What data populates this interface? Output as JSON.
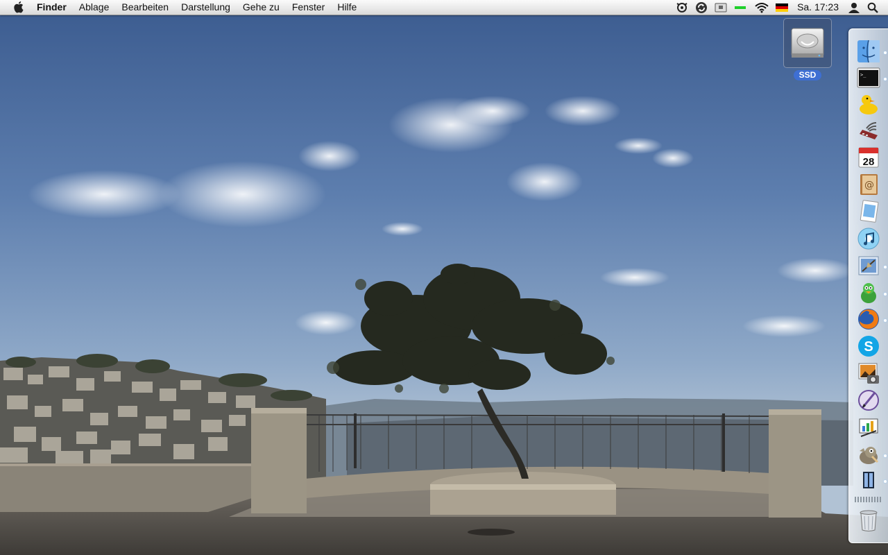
{
  "menubar": {
    "apple_icon": "apple-logo-icon",
    "app_name": "Finder",
    "menus": [
      "Ablage",
      "Bearbeiten",
      "Darstellung",
      "Gehe zu",
      "Fenster",
      "Hilfe"
    ],
    "status_icons": [
      "time-machine-icon",
      "sync-icon",
      "display-icon",
      "battery-icon",
      "wifi-icon",
      "german-flag-icon"
    ],
    "clock": "Sa. 17:23",
    "user_icon": "user-icon",
    "spotlight_icon": "spotlight-search-icon"
  },
  "desktop": {
    "disk_label": "SSD",
    "disk_icon": "hard-drive-icon"
  },
  "dock": {
    "items": [
      {
        "name": "finder-icon",
        "running": true
      },
      {
        "name": "terminal-icon",
        "running": true
      },
      {
        "name": "cyberduck-icon",
        "running": false
      },
      {
        "name": "network-utility-icon",
        "running": false
      },
      {
        "name": "calendar-icon",
        "running": false,
        "text": "28"
      },
      {
        "name": "address-book-icon",
        "running": false
      },
      {
        "name": "preview-icon",
        "running": false
      },
      {
        "name": "itunes-icon",
        "running": false
      },
      {
        "name": "mail-icon",
        "running": true
      },
      {
        "name": "adium-icon",
        "running": true
      },
      {
        "name": "firefox-icon",
        "running": true
      },
      {
        "name": "skype-icon",
        "running": false
      },
      {
        "name": "iphoto-icon",
        "running": false
      },
      {
        "name": "pen-tool-icon",
        "running": false
      },
      {
        "name": "keynote-icon",
        "running": false
      },
      {
        "name": "gimp-icon",
        "running": true
      },
      {
        "name": "columns-app-icon",
        "running": true
      },
      {
        "name": "trash-icon",
        "running": false
      }
    ]
  },
  "colors": {
    "sky_top": "#3d5f93",
    "sky_bottom": "#a9bdd3",
    "selection_blue": "#3e6fd3"
  }
}
